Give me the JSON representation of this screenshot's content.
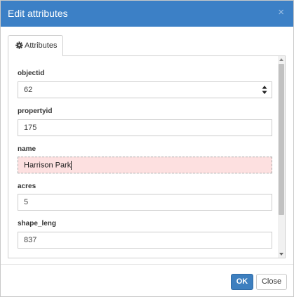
{
  "dialog": {
    "title": "Edit attributes",
    "close_glyph": "×"
  },
  "tab": {
    "label": "Attributes",
    "icon": "gear-icon"
  },
  "fields": [
    {
      "label": "objectid",
      "value": "62"
    },
    {
      "label": "propertyid",
      "value": "175"
    },
    {
      "label": "name",
      "value": "Harrison Park"
    },
    {
      "label": "acres",
      "value": "5"
    },
    {
      "label": "shape_leng",
      "value": "837"
    }
  ],
  "buttons": {
    "ok": "OK",
    "close": "Close"
  },
  "colors": {
    "header": "#3c80c6",
    "primary_button": "#3d7fbf",
    "highlight_field": "#fde0e0"
  }
}
